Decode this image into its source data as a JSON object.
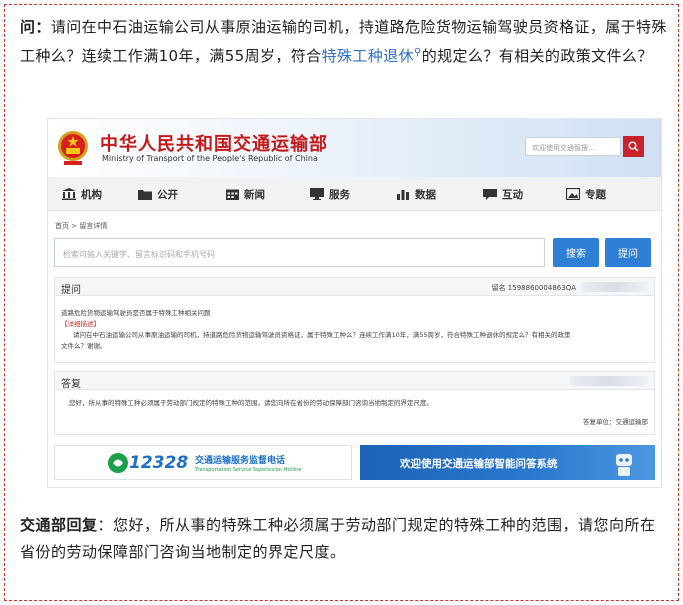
{
  "question": {
    "label": "问：",
    "text_before": "请问在中石油运输公司从事原油运输的司机，持道路危险货物运输驾驶员资格证，属于特殊工种么？连续工作满10年，满55周岁，符合",
    "link": "特殊工种退休",
    "text_after": "的规定么？有相关的政策文件么？"
  },
  "site": {
    "title": "中华人民共和国交通运输部",
    "subtitle": "Ministry of Transport of the People's Republic of China",
    "search_placeholder": "欢迎使用交通智搜...",
    "nav": [
      {
        "label": "机构",
        "icon": "building-icon"
      },
      {
        "label": "公开",
        "icon": "folder-icon"
      },
      {
        "label": "新闻",
        "icon": "calendar-icon"
      },
      {
        "label": "服务",
        "icon": "monitor-icon"
      },
      {
        "label": "数据",
        "icon": "chart-icon"
      },
      {
        "label": "互动",
        "icon": "chat-icon"
      },
      {
        "label": "专题",
        "icon": "image-icon"
      }
    ],
    "breadcrumb": "首页 > 留言详情",
    "main_search_placeholder": "检索可输入关键字、留言标识码和手机号码",
    "search_button": "搜索",
    "ask_button": "提问",
    "ask_section": {
      "title": "提问",
      "id_label": "留名 1598860004863QA",
      "subject": "道路危险货物运输驾驶员是否属于特殊工种相关问题",
      "detail_label": "【详细描述】",
      "detail_line1": "请问在中石油运输公司从事原油运输的司机，持道路危险货物运输驾驶员资格证，属于特殊工种么？连续工作满10年，满55周岁，符合特殊工种退休的规定么？有相关的政策",
      "detail_line2": "文件么？谢谢。"
    },
    "reply_section": {
      "title": "答复",
      "content": "您好，所从事的特殊工种必须属于劳动部门规定的特殊工种的范围，请您向所在省份的劳动保障部门咨询当地制定的界定尺度。",
      "unit": "答复单位：交通运输部"
    },
    "hotline_number": "12328",
    "hotline_title": "交通运输服务监督电话",
    "hotline_subtitle": "Transportation Service Supervision Hotline",
    "ai_banner": "欢迎使用交通运输部智能问答系统"
  },
  "answer": {
    "label": "交通部回复",
    "text": "：您好，所从事的特殊工种必须属于劳动部门规定的特殊工种的范围，请您向所在省份的劳动保障部门咨询当地制定的界定尺度。"
  },
  "colors": {
    "frame": "#c0392b",
    "link": "#2f6fc7",
    "brand_red": "#c21a1a",
    "button_blue": "#2f7fd6"
  }
}
